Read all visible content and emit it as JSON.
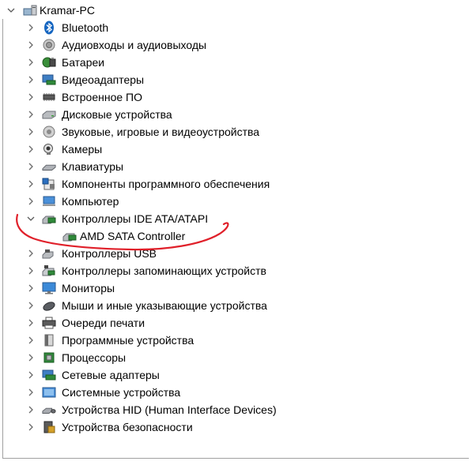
{
  "root": {
    "label": "Kramar-PC",
    "icon": "computer-icon",
    "expanded": true
  },
  "categories": [
    {
      "label": "Bluetooth",
      "icon": "bluetooth-icon",
      "expanded": false
    },
    {
      "label": "Аудиовходы и аудиовыходы",
      "icon": "speaker-icon",
      "expanded": false
    },
    {
      "label": "Батареи",
      "icon": "battery-icon",
      "expanded": false
    },
    {
      "label": "Видеоадаптеры",
      "icon": "display-adapter-icon",
      "expanded": false
    },
    {
      "label": "Встроенное ПО",
      "icon": "firmware-chip-icon",
      "expanded": false
    },
    {
      "label": "Дисковые устройства",
      "icon": "disk-drive-icon",
      "expanded": false
    },
    {
      "label": "Звуковые, игровые и видеоустройства",
      "icon": "sound-icon",
      "expanded": false
    },
    {
      "label": "Камеры",
      "icon": "camera-icon",
      "expanded": false
    },
    {
      "label": "Клавиатуры",
      "icon": "keyboard-icon",
      "expanded": false
    },
    {
      "label": "Компоненты программного обеспечения",
      "icon": "software-component-icon",
      "expanded": false
    },
    {
      "label": "Компьютер",
      "icon": "computer-icon",
      "expanded": false
    },
    {
      "label": "Контроллеры IDE ATA/ATAPI",
      "icon": "ide-controller-icon",
      "expanded": true,
      "children": [
        {
          "label": "AMD SATA Controller",
          "icon": "ide-controller-icon"
        }
      ]
    },
    {
      "label": "Контроллеры USB",
      "icon": "usb-icon",
      "expanded": false
    },
    {
      "label": "Контроллеры запоминающих устройств",
      "icon": "storage-controller-icon",
      "expanded": false
    },
    {
      "label": "Мониторы",
      "icon": "monitor-icon",
      "expanded": false
    },
    {
      "label": "Мыши и иные указывающие устройства",
      "icon": "mouse-icon",
      "expanded": false
    },
    {
      "label": "Очереди печати",
      "icon": "printer-icon",
      "expanded": false
    },
    {
      "label": "Программные устройства",
      "icon": "software-device-icon",
      "expanded": false
    },
    {
      "label": "Процессоры",
      "icon": "processor-icon",
      "expanded": false
    },
    {
      "label": "Сетевые адаптеры",
      "icon": "network-adapter-icon",
      "expanded": false
    },
    {
      "label": "Системные устройства",
      "icon": "system-device-icon",
      "expanded": false
    },
    {
      "label": "Устройства HID (Human Interface Devices)",
      "icon": "hid-icon",
      "expanded": false
    },
    {
      "label": "Устройства безопасности",
      "icon": "security-device-icon",
      "expanded": false
    }
  ],
  "annotation": {
    "color": "#e0202a",
    "icon": "hand-drawn-circle-highlight"
  }
}
